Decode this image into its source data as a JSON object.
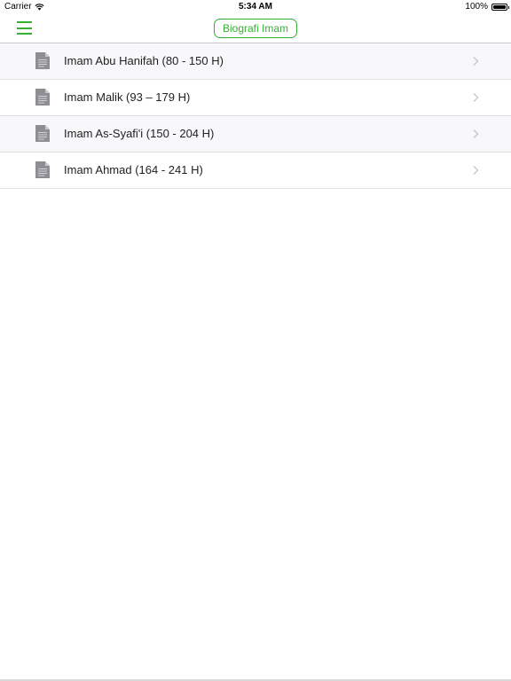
{
  "status_bar": {
    "carrier": "Carrier",
    "time": "5:34 AM",
    "battery_percent": "100%",
    "battery_level": 1.0
  },
  "nav_bar": {
    "menu_icon": "hamburger-menu-icon",
    "title": "Biografi Imam",
    "accent_color": "#35b235"
  },
  "list": {
    "items": [
      {
        "label": "Imam Abu Hanifah (80 - 150 H)",
        "icon": "document-icon"
      },
      {
        "label": "Imam Malik (93 – 179 H)",
        "icon": "document-icon"
      },
      {
        "label": "Imam As-Syafi'i (150 - 204 H)",
        "icon": "document-icon"
      },
      {
        "label": "Imam Ahmad (164 - 241 H)",
        "icon": "document-icon"
      }
    ],
    "disclosure_icon": "chevron-right-icon"
  }
}
